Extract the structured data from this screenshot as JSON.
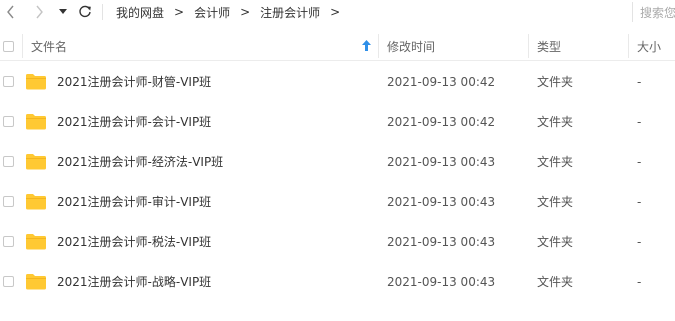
{
  "toolbar": {
    "back_icon": "chevron-left-icon",
    "forward_icon": "chevron-right-icon",
    "history_icon": "caret-down-icon",
    "refresh_icon": "refresh-icon",
    "breadcrumb": [
      "我的网盘",
      "会计师",
      "注册会计师"
    ],
    "breadcrumb_separator": ">",
    "search_placeholder": "搜索您"
  },
  "columns": {
    "name": "文件名",
    "modified": "修改时间",
    "type": "类型",
    "size": "大小",
    "sort_icon": "sort-up-arrow-icon",
    "sort_color": "#2f8fe8"
  },
  "files": [
    {
      "name": "2021注册会计师-财管-VIP班",
      "modified": "2021-09-13 00:42",
      "type": "文件夹",
      "size": "-"
    },
    {
      "name": "2021注册会计师-会计-VIP班",
      "modified": "2021-09-13 00:42",
      "type": "文件夹",
      "size": "-"
    },
    {
      "name": "2021注册会计师-经济法-VIP班",
      "modified": "2021-09-13 00:43",
      "type": "文件夹",
      "size": "-"
    },
    {
      "name": "2021注册会计师-审计-VIP班",
      "modified": "2021-09-13 00:43",
      "type": "文件夹",
      "size": "-"
    },
    {
      "name": "2021注册会计师-税法-VIP班",
      "modified": "2021-09-13 00:43",
      "type": "文件夹",
      "size": "-"
    },
    {
      "name": "2021注册会计师-战略-VIP班",
      "modified": "2021-09-13 00:43",
      "type": "文件夹",
      "size": "-"
    }
  ],
  "folder_icon": "folder-icon",
  "folder_color": "#ffc933"
}
